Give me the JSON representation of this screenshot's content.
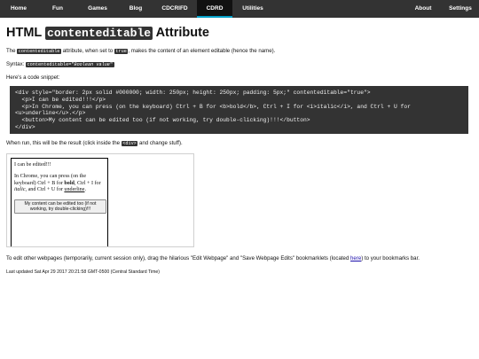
{
  "nav": {
    "left": [
      {
        "label": "Home",
        "active": false
      },
      {
        "label": "Fun",
        "active": false
      },
      {
        "label": "Games",
        "active": false
      },
      {
        "label": "Blog",
        "active": false
      },
      {
        "label": "CDCRIFD",
        "active": false
      },
      {
        "label": "CDRD",
        "active": true
      },
      {
        "label": "Utilities",
        "active": false
      }
    ],
    "right": [
      {
        "label": "About"
      },
      {
        "label": "Settings"
      }
    ],
    "bg_color": "#333333",
    "active_accent": "#00a0c8"
  },
  "title": {
    "prefix": "HTML",
    "code": "contenteditable",
    "suffix": "Attribute"
  },
  "intro": {
    "pre": "The",
    "code1": "contenteditable",
    "mid": "attribute, when set to",
    "code2": "true",
    "post": ", makes the content of an element editable (hence the name)."
  },
  "syntax": {
    "label": "Syntax:",
    "code_pre": "contenteditable=\"",
    "code_italic": "Boolean value",
    "code_post": "\""
  },
  "snippet_label": "Here's a code snippet:",
  "code_lines": [
    "<div style=\"border: 2px solid #000000; width: 250px; height: 250px; padding: 5px;\" contenteditable=\"true\">",
    "  <p>I can be edited!!!</p>",
    "  <p>In Chrome, you can press (on the keyboard) Ctrl + B for <b>bold</b>, Ctrl + I for <i>italic</i>, and Ctrl + U for",
    "<u>underline</u>.</p>",
    "  <button>My content can be edited too (if not working, try double-clicking)!!!</button>",
    "</div>"
  ],
  "result_note": {
    "pre": "When run, this will be the result (click inside the",
    "code": "<div>",
    "post": "and change stuff)."
  },
  "demo": {
    "p1": "I can be edited!!!",
    "p2_a": "In Chrome, you can press (on the keyboard) Ctrl + B for ",
    "p2_bold": "bold",
    "p2_b": ", Ctrl + I for ",
    "p2_italic": "italic",
    "p2_c": ", and Ctrl + U for ",
    "p2_underline": "underline",
    "p2_d": ".",
    "button": "My content can be edited too (if not working, try double-clicking)!!!"
  },
  "bookmarklet_note": {
    "pre": "To edit other webpages (temporarily, current session only), drag the hilarious \"Edit Webpage\" and \"Save Webpage Edits\" bookmarklets (located",
    "link": "here",
    "post": ") to your bookmarks bar."
  },
  "last_updated": "Last updated Sat Apr 29 2017 20:21:58 GMT-0500 (Central Standard Time)"
}
